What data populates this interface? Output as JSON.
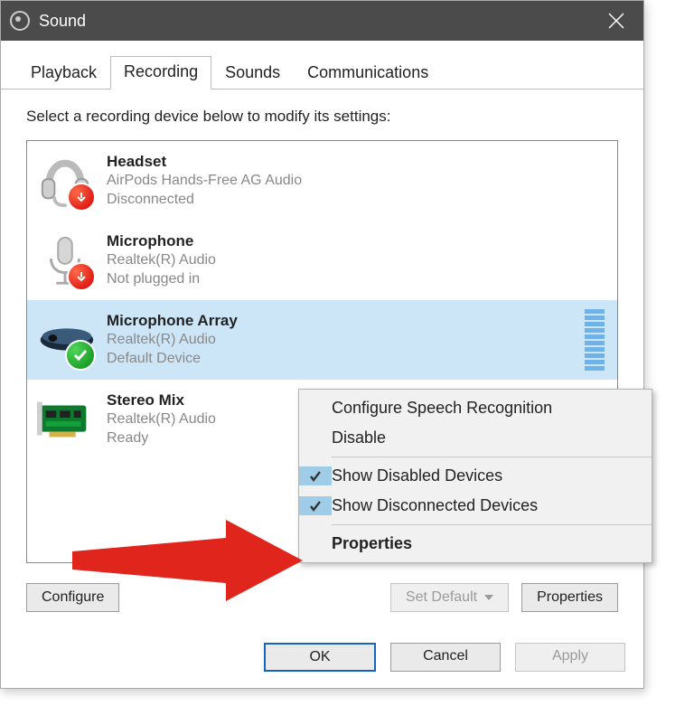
{
  "window": {
    "title": "Sound"
  },
  "tabs": [
    {
      "label": "Playback"
    },
    {
      "label": "Recording"
    },
    {
      "label": "Sounds"
    },
    {
      "label": "Communications"
    }
  ],
  "active_tab_index": 1,
  "instruction": "Select a recording device below to modify its settings:",
  "devices": [
    {
      "name": "Headset",
      "provider": "AirPods Hands-Free AG Audio",
      "status": "Disconnected",
      "icon": "headset",
      "badge": "down-red"
    },
    {
      "name": "Microphone",
      "provider": "Realtek(R) Audio",
      "status": "Not plugged in",
      "icon": "microphone",
      "badge": "down-red"
    },
    {
      "name": "Microphone Array",
      "provider": "Realtek(R) Audio",
      "status": "Default Device",
      "icon": "mic-array",
      "badge": "check-green",
      "selected": true,
      "meter": true
    },
    {
      "name": "Stereo Mix",
      "provider": "Realtek(R) Audio",
      "status": "Ready",
      "icon": "soundcard"
    }
  ],
  "buttons": {
    "configure": "Configure",
    "set_default": "Set Default",
    "properties": "Properties",
    "ok": "OK",
    "cancel": "Cancel",
    "apply": "Apply"
  },
  "context_menu": {
    "configure_speech": "Configure Speech Recognition",
    "disable": "Disable",
    "show_disabled": "Show Disabled Devices",
    "show_disconnected": "Show Disconnected Devices",
    "properties": "Properties"
  }
}
